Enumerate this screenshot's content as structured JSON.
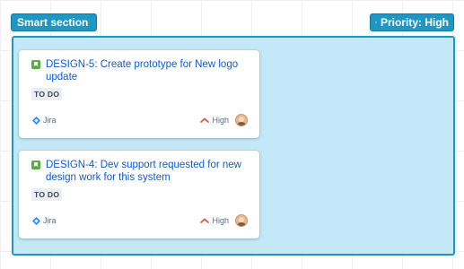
{
  "section": {
    "label": "Smart section"
  },
  "filter": {
    "priority_label": "Priority: High"
  },
  "colors": {
    "accent": "#1f97c4",
    "section_fill": "#c3e9f8",
    "title_link": "#0c5bd6",
    "story_green": "#5aac44",
    "priority_high": "#e5493a"
  },
  "cards": [
    {
      "title": "DESIGN-5: Create prototype for New logo update",
      "status": "TO DO",
      "source": "Jira",
      "priority": "High",
      "type_icon": "story-icon",
      "assignee_icon": "avatar"
    },
    {
      "title": "DESIGN-4: Dev support requested for new design work for this system",
      "status": "TO DO",
      "source": "Jira",
      "priority": "High",
      "type_icon": "story-icon",
      "assignee_icon": "avatar"
    }
  ]
}
